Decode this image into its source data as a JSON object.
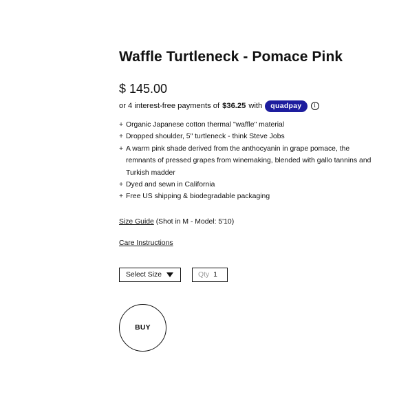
{
  "product": {
    "title": "Waffle Turtleneck - Pomace Pink",
    "price": "$ 145.00",
    "installments": {
      "prefix": "or 4 interest-free payments of",
      "amount": "$36.25",
      "suffix": "with",
      "provider": "quadpay",
      "provider_color": "#1d1d9e",
      "info_glyph": "i"
    },
    "features": [
      {
        "marker": "+",
        "text": "Organic Japanese cotton thermal \"waffle\" material"
      },
      {
        "marker": "+",
        "text": "Dropped shoulder, 5\" turtleneck - think Steve Jobs"
      },
      {
        "marker": "+",
        "text": "A warm pink shade derived from the anthocyanin in grape pomace, the remnants of pressed grapes from winemaking, blended with gallo tannins and Turkish madder"
      },
      {
        "marker": "+",
        "text": "Dyed and sewn in California"
      },
      {
        "marker": "+",
        "text": "Free US shipping & biodegradable packaging"
      }
    ],
    "size_guide": {
      "link": "Size Guide",
      "note": "(Shot in M - Model: 5'10)"
    },
    "care_link": "Care Instructions",
    "size_select": {
      "label": "Select Size",
      "icon": "caret-down-icon"
    },
    "quantity": {
      "label": "Qty",
      "value": "1"
    },
    "buy_label": "BUY"
  }
}
